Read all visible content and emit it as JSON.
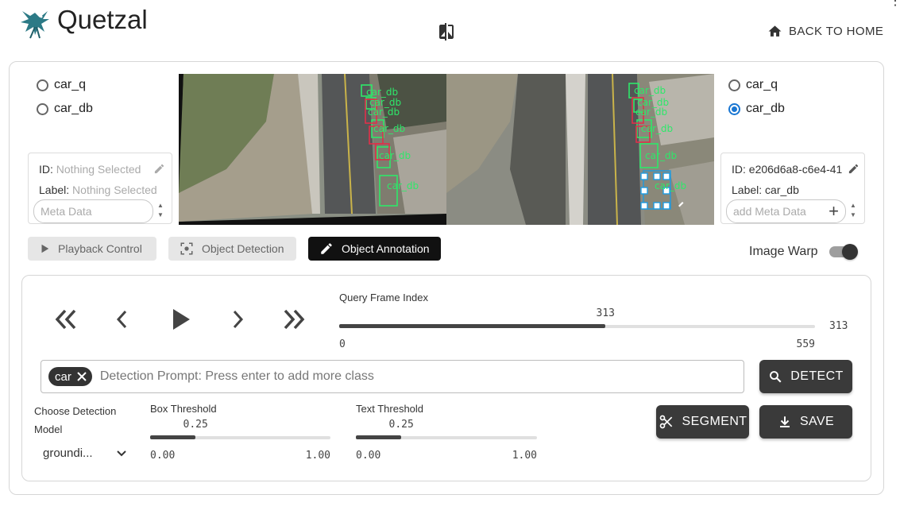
{
  "app": {
    "title": "Quetzal",
    "back_home": "BACK TO HOME",
    "more_menu": "⋮"
  },
  "left_panel": {
    "options": [
      "car_q",
      "car_db"
    ],
    "selected": null,
    "id_label": "ID:",
    "id_value": "Nothing Selected",
    "label_label": "Label:",
    "label_value": "Nothing Selected",
    "meta_placeholder": "Meta Data"
  },
  "right_panel": {
    "options": [
      "car_q",
      "car_db"
    ],
    "selected": "car_db",
    "id_label": "ID:",
    "id_value": "e206d6a8-c6e4-41",
    "label_label": "Label:",
    "label_value": "car_db",
    "meta_placeholder": "add Meta Data"
  },
  "images": {
    "box_label": "car_db"
  },
  "modes": {
    "playback": "Playback Control",
    "detection": "Object Detection",
    "annotation": "Object Annotation",
    "active": "Object Annotation"
  },
  "image_warp": {
    "label": "Image Warp",
    "enabled": true
  },
  "playback": {
    "frame_label": "Query Frame Index",
    "frame_value": "313",
    "frame_min": "0",
    "frame_max": "559",
    "frame_display": "313",
    "frame_fraction": 0.56
  },
  "detection": {
    "chip": "car",
    "prompt_placeholder": "Detection Prompt: Press enter to add more class",
    "detect_label": "DETECT",
    "segment_label": "SEGMENT",
    "save_label": "SAVE",
    "model_label_1": "Choose Detection",
    "model_label_2": "Model",
    "model_value": "groundi...",
    "box_threshold_label": "Box Threshold",
    "box_threshold_value": "0.25",
    "box_threshold_fraction": 0.25,
    "box_min": "0.00",
    "box_max": "1.00",
    "text_threshold_label": "Text Threshold",
    "text_threshold_value": "0.25",
    "text_threshold_fraction": 0.25,
    "text_min": "0.00",
    "text_max": "1.00"
  },
  "colors": {
    "accent": "#1976d2",
    "dark": "#3a3a3a",
    "box_green": "#2ee86a",
    "box_red": "#e0304a",
    "box_blue": "#1e9be0"
  }
}
